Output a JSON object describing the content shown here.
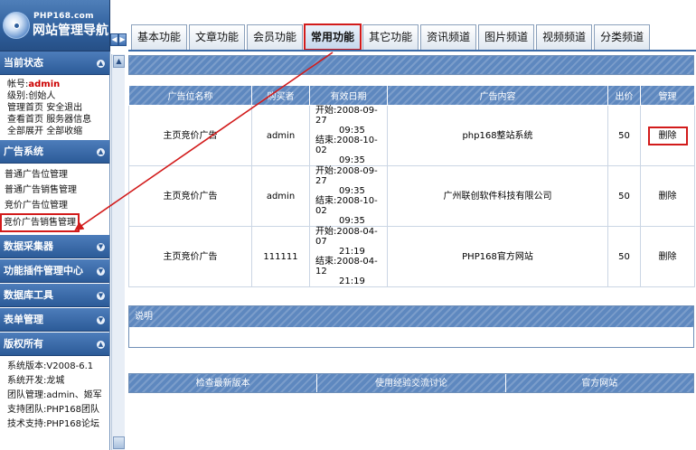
{
  "logo": {
    "site": "PHP168.com",
    "title": "网站管理导航"
  },
  "tabs": [
    "基本功能",
    "文章功能",
    "会员功能",
    "常用功能",
    "其它功能",
    "资讯频道",
    "图片频道",
    "视频频道",
    "分类频道"
  ],
  "active_tab": "常用功能",
  "sidebar": {
    "status": {
      "title": "当前状态",
      "account_label": "帐号:",
      "account_value": "admin",
      "level_label": "级别:",
      "level_value": "创始人",
      "links_row1": [
        "管理首页",
        "安全退出"
      ],
      "links_row2": [
        "查看首页",
        "服务器信息"
      ],
      "links_row3": [
        "全部展开",
        "全部收缩"
      ]
    },
    "ads": {
      "title": "广告系统",
      "items": [
        "普通广告位管理",
        "普通广告销售管理",
        "竞价广告位管理",
        "竞价广告销售管理"
      ],
      "highlighted_item": "竞价广告销售管理"
    },
    "collapsed_sections": [
      "数据采集器",
      "功能插件管理中心",
      "数据库工具",
      "表单管理"
    ],
    "copyright": {
      "title": "版权所有",
      "lines": [
        "系统版本:V2008-6.1",
        "系统开发:龙城",
        "团队管理:admin、姬军",
        "支持团队:PHP168团队",
        "技术支持:PHP168论坛"
      ]
    }
  },
  "ad_table": {
    "headers": [
      "广告位名称",
      "购买者",
      "有效日期",
      "广告内容",
      "出价",
      "管理"
    ],
    "rows": [
      {
        "name": "主页竞价广告",
        "buyer": "admin",
        "start": "开始:2008-09-27",
        "start_time": "09:35",
        "end": "结束:2008-10-02",
        "end_time": "09:35",
        "content": "php168整站系统",
        "price": "50",
        "action": "删除"
      },
      {
        "name": "主页竞价广告",
        "buyer": "admin",
        "start": "开始:2008-09-27",
        "start_time": "09:35",
        "end": "结束:2008-10-02",
        "end_time": "09:35",
        "content": "广州联创软件科技有限公司",
        "price": "50",
        "action": "删除"
      },
      {
        "name": "主页竞价广告",
        "buyer": "111111",
        "start": "开始:2008-04-07",
        "start_time": "21:19",
        "end": "结束:2008-04-12",
        "end_time": "21:19",
        "content": "PHP168官方网站",
        "price": "50",
        "action": "删除"
      }
    ]
  },
  "note": {
    "title": "说明"
  },
  "footer_links": [
    "检查最新版本",
    "使用经验交流讨论",
    "官方网站"
  ],
  "colors": {
    "header_blue": "#5e88bf",
    "sidebar_blue": "#2c5b98",
    "highlight_red": "#d21b1b"
  }
}
